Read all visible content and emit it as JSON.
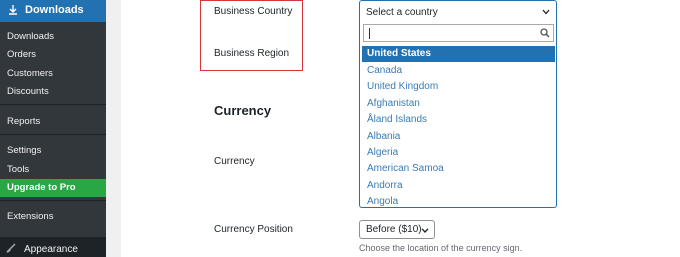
{
  "sidebar": {
    "top_label": "Downloads",
    "items": [
      "Downloads",
      "Orders",
      "Customers",
      "Discounts",
      "Reports",
      "Settings",
      "Tools"
    ],
    "pro_label": "Upgrade to Pro",
    "extensions_label": "Extensions",
    "appearance_label": "Appearance"
  },
  "form": {
    "business_country_label": "Business Country",
    "business_region_label": "Business Region",
    "currency_section_title": "Currency",
    "currency_label": "Currency",
    "currency_position_label": "Currency Position",
    "currency_position_value": "Before ($10)",
    "currency_position_help": "Choose the location of the currency sign."
  },
  "country_select": {
    "placeholder": "Select a country",
    "options": [
      "United States",
      "Canada",
      "United Kingdom",
      "Afghanistan",
      "Åland Islands",
      "Albania",
      "Algeria",
      "American Samoa",
      "Andorra",
      "Angola"
    ],
    "selected": "United States"
  },
  "colors": {
    "sidebar_bg": "#23282d",
    "accent": "#2271b1",
    "pro_green": "#28a744",
    "highlight_red": "#d63638"
  }
}
